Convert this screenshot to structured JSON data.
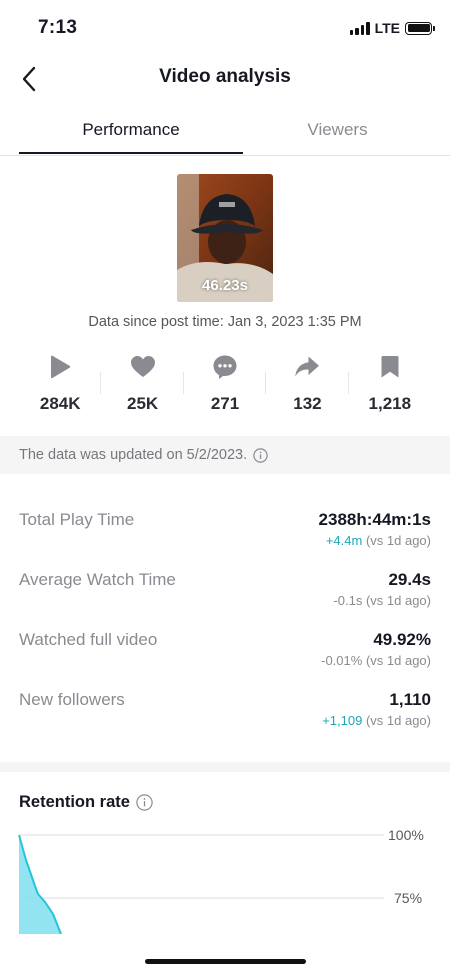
{
  "status_bar": {
    "time": "7:13",
    "network": "LTE"
  },
  "nav": {
    "title": "Video analysis"
  },
  "tabs": [
    {
      "label": "Performance",
      "active": true
    },
    {
      "label": "Viewers",
      "active": false
    }
  ],
  "video": {
    "duration": "46.23s"
  },
  "data_since": "Data since post time: Jan 3, 2023 1:35 PM",
  "stats": [
    {
      "icon": "play-icon",
      "value": "284K"
    },
    {
      "icon": "heart-icon",
      "value": "25K"
    },
    {
      "icon": "comment-icon",
      "value": "271"
    },
    {
      "icon": "share-icon",
      "value": "132"
    },
    {
      "icon": "bookmark-icon",
      "value": "1,218"
    }
  ],
  "update_banner": "The data was updated on 5/2/2023.",
  "metrics": [
    {
      "label": "Total Play Time",
      "value": "2388h:44m:1s",
      "delta": "+4.4m",
      "comparison": "(vs 1d ago)",
      "trend": "up"
    },
    {
      "label": "Average Watch Time",
      "value": "29.4s",
      "delta": "-0.1s",
      "comparison": "(vs 1d ago)",
      "trend": "down"
    },
    {
      "label": "Watched full video",
      "value": "49.92%",
      "delta": "-0.01%",
      "comparison": "(vs 1d ago)",
      "trend": "down"
    },
    {
      "label": "New followers",
      "value": "1,110",
      "delta": "+1,109",
      "comparison": "(vs 1d ago)",
      "trend": "up"
    }
  ],
  "retention": {
    "title": "Retention rate",
    "tick_labels": [
      "100%",
      "75%"
    ]
  },
  "colors": {
    "accent_teal": "#20a5b7",
    "chart_fill": "#7fdfee",
    "chart_line": "#25c4dc",
    "icon_gray": "#8a8b91"
  }
}
